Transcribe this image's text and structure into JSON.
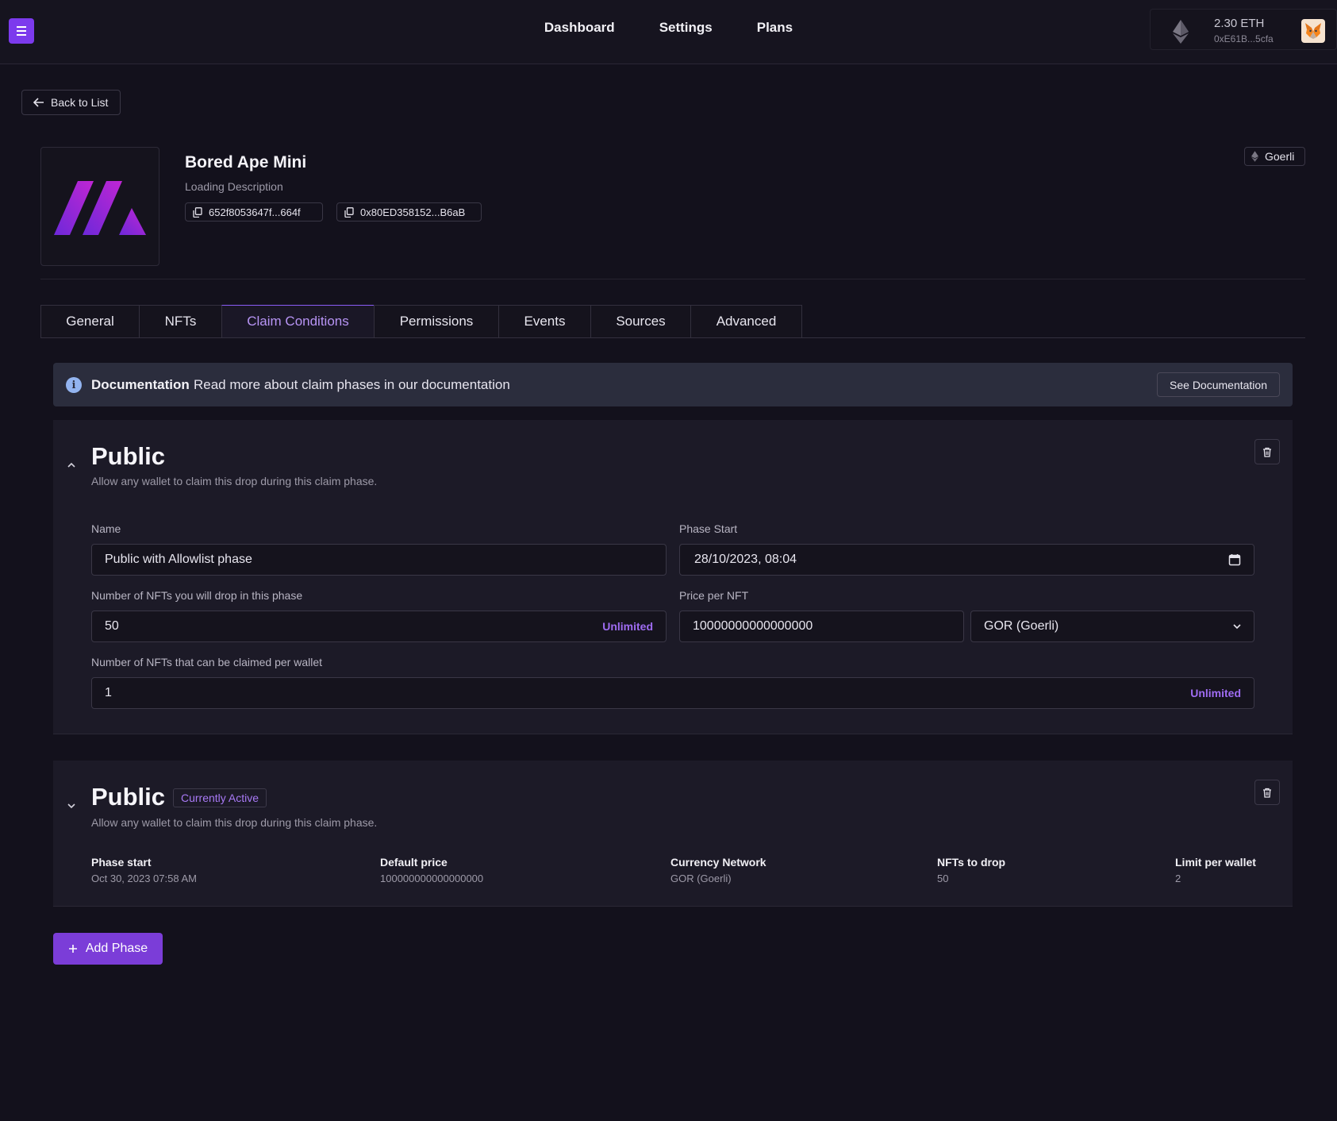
{
  "header": {
    "nav": [
      "Dashboard",
      "Settings",
      "Plans"
    ],
    "wallet": {
      "balance": "2.30 ETH",
      "address": "0xE61B...5cfa"
    }
  },
  "back": {
    "label": "Back to List"
  },
  "contract": {
    "title": "Bored Ape Mini",
    "description": "Loading Description",
    "id_chip": "652f8053647f...664f",
    "address_chip": "0x80ED358152...B6aB",
    "network": "Goerli"
  },
  "tabs": [
    "General",
    "NFTs",
    "Claim Conditions",
    "Permissions",
    "Events",
    "Sources",
    "Advanced"
  ],
  "active_tab": "Claim Conditions",
  "doc": {
    "title": "Documentation",
    "text": "Read more about claim phases in our documentation",
    "button": "See Documentation"
  },
  "phase1": {
    "title": "Public",
    "description": "Allow any wallet to claim this drop during this claim phase.",
    "name_label": "Name",
    "name_value": "Public with Allowlist phase",
    "start_label": "Phase Start",
    "start_value": "28/10/2023, 08:04",
    "drop_label": "Number of NFTs you will drop in this phase",
    "drop_value": "50",
    "price_label": "Price per NFT",
    "price_value": "10000000000000000",
    "currency_value": "GOR (Goerli)",
    "per_wallet_label": "Number of NFTs that can be claimed per wallet",
    "per_wallet_value": "1",
    "unlimited": "Unlimited"
  },
  "phase2": {
    "title": "Public",
    "badge": "Currently Active",
    "description": "Allow any wallet to claim this drop during this claim phase.",
    "stats": [
      {
        "label": "Phase start",
        "value": "Oct 30, 2023 07:58 AM"
      },
      {
        "label": "Default price",
        "value": "100000000000000000"
      },
      {
        "label": "Currency Network",
        "value": "GOR (Goerli)"
      },
      {
        "label": "NFTs to drop",
        "value": "50"
      },
      {
        "label": "Limit per wallet",
        "value": "2"
      }
    ]
  },
  "add_phase": {
    "label": "Add Phase"
  },
  "colors": {
    "accent": "#7b3dd8",
    "accent_text": "#b794f4",
    "background": "#13111c"
  },
  "icons": [
    "menu-icon",
    "ethereum-icon",
    "metamask-fox-icon",
    "arrow-left-icon",
    "copy-icon",
    "info-icon",
    "chevron-up-icon",
    "chevron-down-icon",
    "trash-icon",
    "calendar-icon",
    "plus-icon"
  ]
}
